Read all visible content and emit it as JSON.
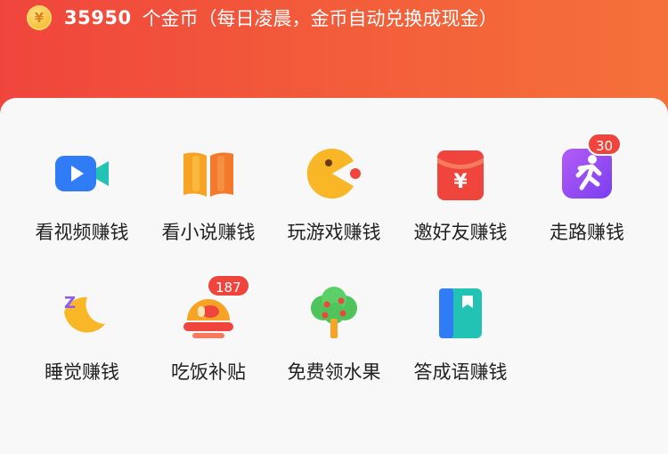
{
  "header": {
    "coin_symbol": "¥",
    "coin_count": "35950",
    "coin_desc": "个金币（每日凌晨，金币自动兑换成现金）"
  },
  "tasks": [
    {
      "label": "看视频赚钱",
      "icon": "video-camera-icon"
    },
    {
      "label": "看小说赚钱",
      "icon": "book-icon"
    },
    {
      "label": "玩游戏赚钱",
      "icon": "pacman-game-icon"
    },
    {
      "label": "邀好友赚钱",
      "icon": "red-envelope-icon"
    },
    {
      "label": "走路赚钱",
      "icon": "running-person-icon",
      "badge": "30"
    },
    {
      "label": "睡觉赚钱",
      "icon": "moon-sleep-icon"
    },
    {
      "label": "吃饭补贴",
      "icon": "roast-chicken-icon",
      "badge": "187"
    },
    {
      "label": "免费领水果",
      "icon": "fruit-tree-icon"
    },
    {
      "label": "答成语赚钱",
      "icon": "notebook-icon"
    }
  ],
  "colors": {
    "header_start": "#f0453d",
    "header_end": "#f5713a",
    "badge": "#f0453d"
  }
}
